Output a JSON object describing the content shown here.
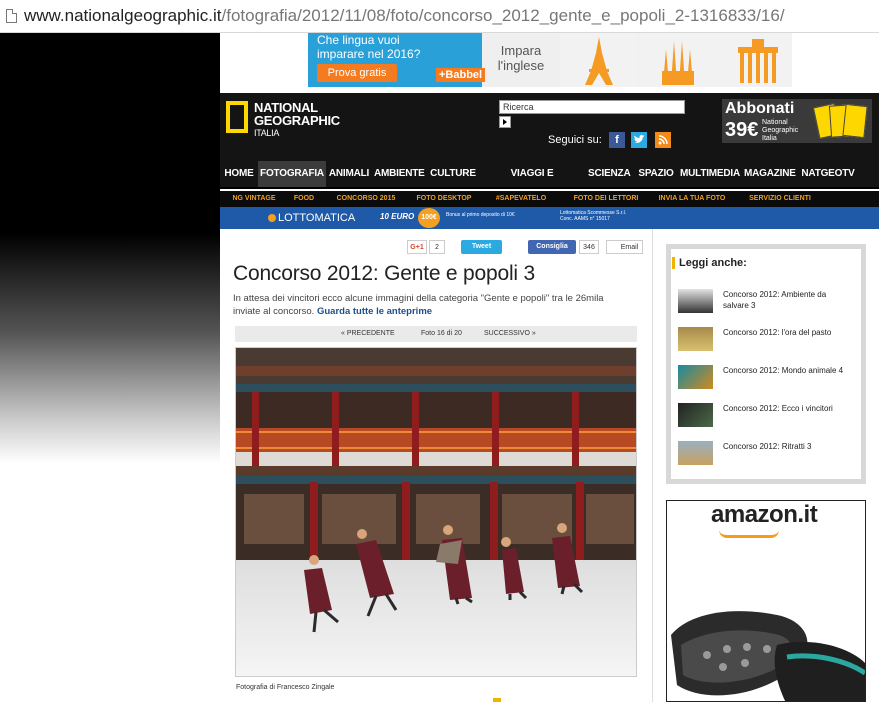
{
  "browser": {
    "url_host": "www.nationalgeographic.it",
    "url_path": "/fotografia/2012/11/08/foto/concorso_2012_gente_e_popoli_2-1316833/16/"
  },
  "ad_banner": {
    "question": "Che lingua vuoi imparare nel 2016?",
    "button_label": "Prova gratis",
    "brand": "+Babbel",
    "impara": "Impara l'inglese"
  },
  "header": {
    "logo_line1": "NATIONAL",
    "logo_line2": "GEOGRAPHIC",
    "logo_line3": "ITALIA",
    "search_placeholder": "Ricerca",
    "follow_label": "Seguici su:",
    "social": [
      "f",
      "t",
      "rss"
    ],
    "subscribe_title": "Abbonati",
    "subscribe_price": "39€",
    "subscribe_sub": "National Geographic Italia"
  },
  "nav": {
    "items": [
      "HOME",
      "FOTOGRAFIA",
      "ANIMALI",
      "AMBIENTE",
      "CULTURE",
      "VIAGGI E AVVENTURE",
      "SCIENZA",
      "SPAZIO",
      "MULTIMEDIA",
      "MAGAZINE",
      "NATGEOTV"
    ],
    "active": "FOTOGRAFIA"
  },
  "subnav": {
    "items": [
      "NG VINTAGE",
      "FOOD",
      "CONCORSO 2015",
      "FOTO DESKTOP",
      "#SAPEVATELO",
      "FOTO DEI LETTORI",
      "INVIA LA TUA FOTO",
      "SERVIZIO CLIENTI"
    ]
  },
  "lotto": {
    "brand": "LOTTOMATICA",
    "euro": "10 EURO",
    "bonus": "100€ BONUS",
    "note": "Bonus al primo deposito di 10€",
    "company": "Lottomatica Scommesse S.r.l. Conc. AAMS n° 15017"
  },
  "share": {
    "gplus": "G+1",
    "gplus_count": "2",
    "tweet": "Tweet",
    "fb": "Consiglia",
    "fb_count": "346",
    "email": "Email"
  },
  "article": {
    "title": "Concorso 2012: Gente e popoli 3",
    "description": "In attesa dei vincitori ecco alcune immagini della categoria \"Gente e popoli\"  tra le 26mila inviate al concorso.",
    "link_text": "Guarda tutte le anteprime",
    "prev": "« PRECEDENTE",
    "counter": "Foto 16 di 20",
    "next": "SUCCESSIVO »",
    "credit": "Fotografia di Francesco Zingale"
  },
  "sidebar": {
    "heading": "Leggi anche:",
    "related": [
      "Concorso 2012: Ambiente da salvare 3",
      "Concorso 2012: l'ora del pasto",
      "Concorso 2012: Mondo animale 4",
      "Concorso 2012: Ecco i vincitori",
      "Concorso 2012: Ritratti 3"
    ],
    "amazon_logo": "amazon.it"
  },
  "colors": {
    "nav_bg": "#141414",
    "subnav_text": "#f0a020",
    "logo_yellow": "#ffd700",
    "link_blue": "#1f4f8b"
  }
}
